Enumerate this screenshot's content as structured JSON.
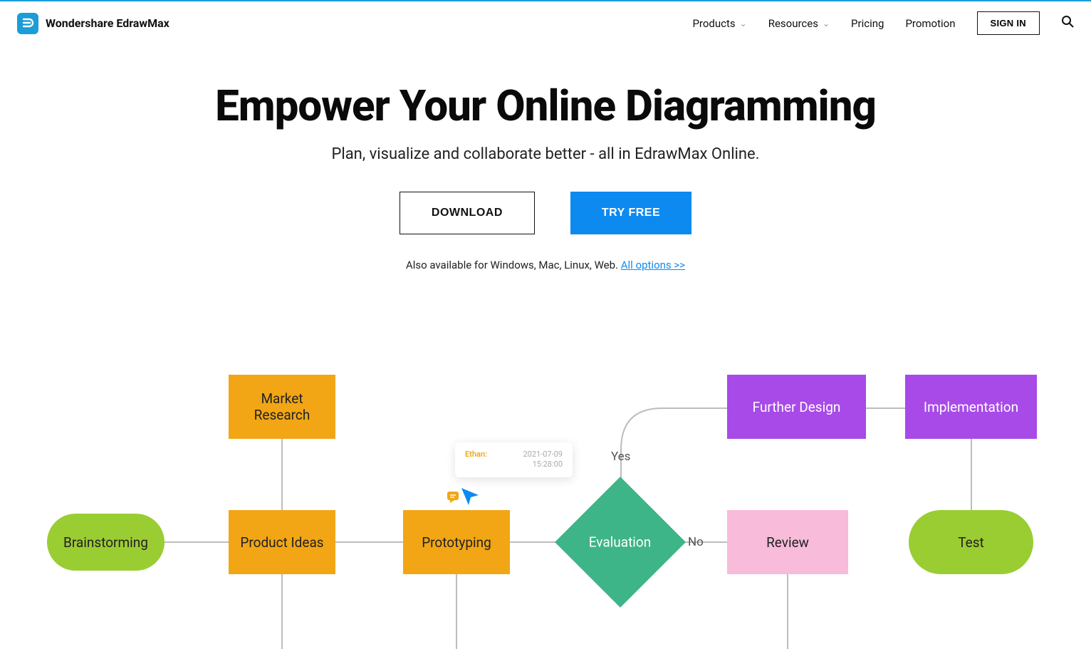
{
  "brand": {
    "name": "Wondershare EdrawMax"
  },
  "nav": {
    "products": "Products",
    "resources": "Resources",
    "pricing": "Pricing",
    "promotion": "Promotion",
    "signin": "SIGN IN"
  },
  "hero": {
    "title": "Empower Your Online Diagramming",
    "subtitle": "Plan, visualize and collaborate better - all in EdrawMax Online.",
    "download": "DOWNLOAD",
    "tryfree": "TRY FREE",
    "avail_prefix": "Also available for Windows, Mac, Linux, Web. ",
    "avail_link": "All options >>"
  },
  "diagram": {
    "nodes": {
      "brainstorming": "Brainstorming",
      "market_research": "Market\nResearch",
      "product_ideas": "Product Ideas",
      "prototyping": "Prototyping",
      "evaluation": "Evaluation",
      "review": "Review",
      "further_design": "Further Design",
      "implementation": "Implementation",
      "test": "Test"
    },
    "edges": {
      "yes": "Yes",
      "no": "No"
    },
    "comment": {
      "author": "Ethan:",
      "date": "2021-07-09",
      "time": "15:28:00"
    }
  }
}
